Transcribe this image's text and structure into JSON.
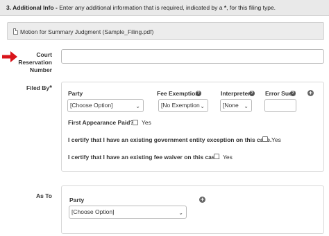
{
  "section": {
    "title": "3. Additional Info - ",
    "desc_prefix": "Enter any additional information that is required, indicated by a ",
    "required_marker": "*",
    "desc_suffix": ", for this filing type."
  },
  "file": {
    "name": "Motion for Summary Judgment (Sample_Filing.pdf)"
  },
  "court_reservation": {
    "label_line1": "Court",
    "label_line2": "Reservation",
    "label_line3": "Number",
    "value": ""
  },
  "filed_by": {
    "label": "Filed By",
    "required_marker": "*",
    "columns": {
      "party": "Party",
      "fee_exemption": "Fee Exemption",
      "interpreter": "Interpreter",
      "error_sued": "Error Sued"
    },
    "party_select": "[Choose Option]",
    "fee_select": "[No Exemption",
    "interpreter_select": "[None",
    "error_sued_value": "",
    "first_appearance_label": "First Appearance Paid?",
    "yes": "Yes",
    "gov_exception_label": "I certify that I have an existing government entity exception on this case.",
    "fee_waiver_label": "I certify that I have an existing fee waiver on this case."
  },
  "as_to": {
    "label": "As To",
    "party_header": "Party",
    "party_select": "[Choose Option]"
  },
  "colors": {
    "arrow": "#d9141b",
    "header_bg": "#e9e9e9"
  },
  "icons": [
    "arrow-right-icon",
    "file-icon",
    "help-icon",
    "plus-icon",
    "chevron-down-icon"
  ]
}
